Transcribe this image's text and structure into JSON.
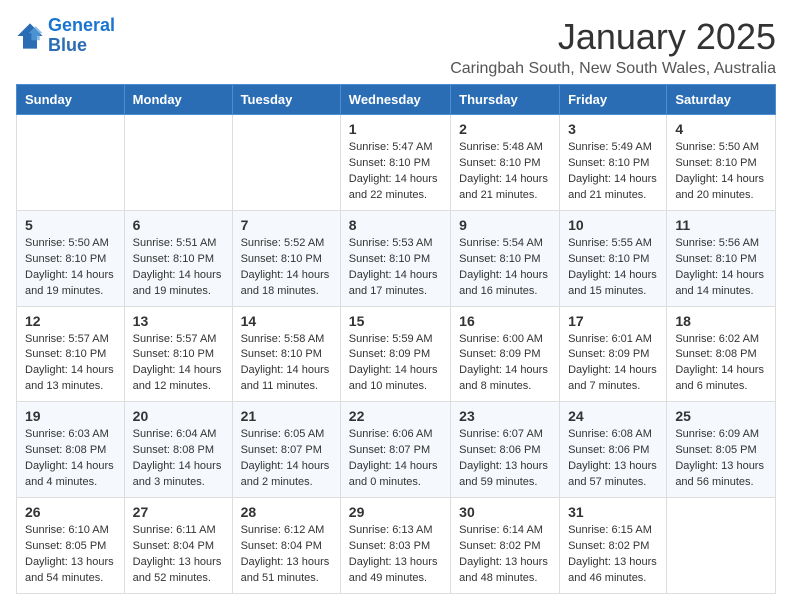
{
  "logo": {
    "line1": "General",
    "line2": "Blue"
  },
  "title": "January 2025",
  "subtitle": "Caringbah South, New South Wales, Australia",
  "weekdays": [
    "Sunday",
    "Monday",
    "Tuesday",
    "Wednesday",
    "Thursday",
    "Friday",
    "Saturday"
  ],
  "weeks": [
    [
      {
        "day": "",
        "info": ""
      },
      {
        "day": "",
        "info": ""
      },
      {
        "day": "",
        "info": ""
      },
      {
        "day": "1",
        "info": "Sunrise: 5:47 AM\nSunset: 8:10 PM\nDaylight: 14 hours and 22 minutes."
      },
      {
        "day": "2",
        "info": "Sunrise: 5:48 AM\nSunset: 8:10 PM\nDaylight: 14 hours and 21 minutes."
      },
      {
        "day": "3",
        "info": "Sunrise: 5:49 AM\nSunset: 8:10 PM\nDaylight: 14 hours and 21 minutes."
      },
      {
        "day": "4",
        "info": "Sunrise: 5:50 AM\nSunset: 8:10 PM\nDaylight: 14 hours and 20 minutes."
      }
    ],
    [
      {
        "day": "5",
        "info": "Sunrise: 5:50 AM\nSunset: 8:10 PM\nDaylight: 14 hours and 19 minutes."
      },
      {
        "day": "6",
        "info": "Sunrise: 5:51 AM\nSunset: 8:10 PM\nDaylight: 14 hours and 19 minutes."
      },
      {
        "day": "7",
        "info": "Sunrise: 5:52 AM\nSunset: 8:10 PM\nDaylight: 14 hours and 18 minutes."
      },
      {
        "day": "8",
        "info": "Sunrise: 5:53 AM\nSunset: 8:10 PM\nDaylight: 14 hours and 17 minutes."
      },
      {
        "day": "9",
        "info": "Sunrise: 5:54 AM\nSunset: 8:10 PM\nDaylight: 14 hours and 16 minutes."
      },
      {
        "day": "10",
        "info": "Sunrise: 5:55 AM\nSunset: 8:10 PM\nDaylight: 14 hours and 15 minutes."
      },
      {
        "day": "11",
        "info": "Sunrise: 5:56 AM\nSunset: 8:10 PM\nDaylight: 14 hours and 14 minutes."
      }
    ],
    [
      {
        "day": "12",
        "info": "Sunrise: 5:57 AM\nSunset: 8:10 PM\nDaylight: 14 hours and 13 minutes."
      },
      {
        "day": "13",
        "info": "Sunrise: 5:57 AM\nSunset: 8:10 PM\nDaylight: 14 hours and 12 minutes."
      },
      {
        "day": "14",
        "info": "Sunrise: 5:58 AM\nSunset: 8:10 PM\nDaylight: 14 hours and 11 minutes."
      },
      {
        "day": "15",
        "info": "Sunrise: 5:59 AM\nSunset: 8:09 PM\nDaylight: 14 hours and 10 minutes."
      },
      {
        "day": "16",
        "info": "Sunrise: 6:00 AM\nSunset: 8:09 PM\nDaylight: 14 hours and 8 minutes."
      },
      {
        "day": "17",
        "info": "Sunrise: 6:01 AM\nSunset: 8:09 PM\nDaylight: 14 hours and 7 minutes."
      },
      {
        "day": "18",
        "info": "Sunrise: 6:02 AM\nSunset: 8:08 PM\nDaylight: 14 hours and 6 minutes."
      }
    ],
    [
      {
        "day": "19",
        "info": "Sunrise: 6:03 AM\nSunset: 8:08 PM\nDaylight: 14 hours and 4 minutes."
      },
      {
        "day": "20",
        "info": "Sunrise: 6:04 AM\nSunset: 8:08 PM\nDaylight: 14 hours and 3 minutes."
      },
      {
        "day": "21",
        "info": "Sunrise: 6:05 AM\nSunset: 8:07 PM\nDaylight: 14 hours and 2 minutes."
      },
      {
        "day": "22",
        "info": "Sunrise: 6:06 AM\nSunset: 8:07 PM\nDaylight: 14 hours and 0 minutes."
      },
      {
        "day": "23",
        "info": "Sunrise: 6:07 AM\nSunset: 8:06 PM\nDaylight: 13 hours and 59 minutes."
      },
      {
        "day": "24",
        "info": "Sunrise: 6:08 AM\nSunset: 8:06 PM\nDaylight: 13 hours and 57 minutes."
      },
      {
        "day": "25",
        "info": "Sunrise: 6:09 AM\nSunset: 8:05 PM\nDaylight: 13 hours and 56 minutes."
      }
    ],
    [
      {
        "day": "26",
        "info": "Sunrise: 6:10 AM\nSunset: 8:05 PM\nDaylight: 13 hours and 54 minutes."
      },
      {
        "day": "27",
        "info": "Sunrise: 6:11 AM\nSunset: 8:04 PM\nDaylight: 13 hours and 52 minutes."
      },
      {
        "day": "28",
        "info": "Sunrise: 6:12 AM\nSunset: 8:04 PM\nDaylight: 13 hours and 51 minutes."
      },
      {
        "day": "29",
        "info": "Sunrise: 6:13 AM\nSunset: 8:03 PM\nDaylight: 13 hours and 49 minutes."
      },
      {
        "day": "30",
        "info": "Sunrise: 6:14 AM\nSunset: 8:02 PM\nDaylight: 13 hours and 48 minutes."
      },
      {
        "day": "31",
        "info": "Sunrise: 6:15 AM\nSunset: 8:02 PM\nDaylight: 13 hours and 46 minutes."
      },
      {
        "day": "",
        "info": ""
      }
    ]
  ]
}
